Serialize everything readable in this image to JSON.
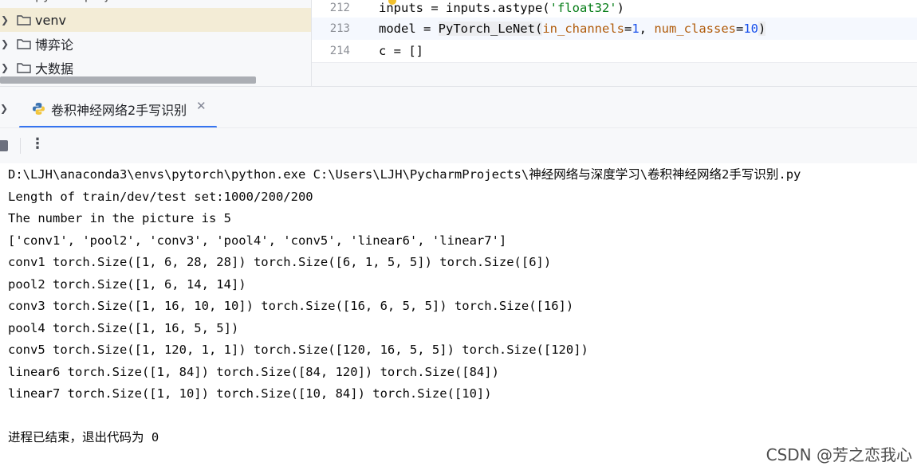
{
  "project_tree": {
    "partial_top_label": "python-project",
    "items": [
      {
        "label": "venv",
        "selected": true
      },
      {
        "label": "博弈论",
        "selected": false
      },
      {
        "label": "大数据",
        "selected": false
      }
    ]
  },
  "editor": {
    "lines": [
      {
        "number": "212",
        "pre": "inputs = inputs.astype(",
        "str": "'float32'",
        "post": ")"
      },
      {
        "number": "213",
        "pre": "model = ",
        "fn": "PyTorch_LeNet",
        "open": "(",
        "p1": "in_channels",
        "eq1": "=",
        "v1": "1",
        "comma": ", ",
        "p2": "num_classes",
        "eq2": "=",
        "v2": "10",
        "close": ")"
      },
      {
        "number": "214",
        "text": "c = []"
      }
    ]
  },
  "run_window": {
    "tab_title": "卷积神经网络2手写识别",
    "console_lines": [
      "D:\\LJH\\anaconda3\\envs\\pytorch\\python.exe C:\\Users\\LJH\\PycharmProjects\\神经网络与深度学习\\卷积神经网络2手写识别.py",
      "Length of train/dev/test set:1000/200/200",
      "The number in the picture is 5",
      "['conv1', 'pool2', 'conv3', 'pool4', 'conv5', 'linear6', 'linear7']",
      "conv1 torch.Size([1, 6, 28, 28]) torch.Size([6, 1, 5, 5]) torch.Size([6])",
      "pool2 torch.Size([1, 6, 14, 14])",
      "conv3 torch.Size([1, 16, 10, 10]) torch.Size([16, 6, 5, 5]) torch.Size([16])",
      "pool4 torch.Size([1, 16, 5, 5])",
      "conv5 torch.Size([1, 120, 1, 1]) torch.Size([120, 16, 5, 5]) torch.Size([120])",
      "linear6 torch.Size([1, 84]) torch.Size([84, 120]) torch.Size([84])",
      "linear7 torch.Size([1, 10]) torch.Size([10, 84]) torch.Size([10])",
      "",
      "进程已结束，退出代码为 0"
    ]
  },
  "watermark": "CSDN @芳之恋我心",
  "icons": {
    "chevron": "chevron-right-icon",
    "folder": "folder-icon",
    "python": "python-icon",
    "close": "close-icon",
    "stop": "stop-icon",
    "more": "more-vertical-icon",
    "bulb": "lightbulb-icon"
  },
  "colors": {
    "selection": "#f3ecd6",
    "accent": "#3574f0",
    "string": "#067d17",
    "param": "#b05b0a",
    "number": "#1750eb"
  }
}
